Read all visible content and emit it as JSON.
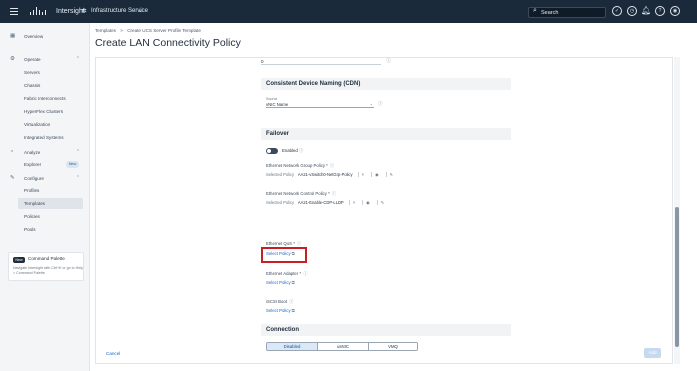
{
  "topbar": {
    "app_name": "Intersight",
    "service_name": "Infrastructure Service",
    "search_placeholder": "Search",
    "icons": [
      "menu-icon",
      "cisco-logo",
      "services-icon",
      "chevron-down-icon",
      "search-icon",
      "status-icon",
      "tasks-icon",
      "notifications-icon",
      "help-icon",
      "user-icon"
    ]
  },
  "sidebar": {
    "overview": "Overview",
    "operate": {
      "label": "Operate",
      "items": [
        "Servers",
        "Chassis",
        "Fabric Interconnects",
        "HyperFlex Clusters",
        "Virtualization",
        "Integrated Systems"
      ]
    },
    "analyze": {
      "label": "Analyze",
      "items": [
        {
          "label": "Explorer",
          "badge": "New"
        }
      ]
    },
    "configure": {
      "label": "Configure",
      "items": [
        "Profiles",
        "Templates",
        "Policies",
        "Pools"
      ],
      "active": "Templates"
    },
    "command_palette": {
      "badge": "New",
      "title": "Command Palette",
      "description": "Navigate Intersight with Ctrl+K or go to Help > Command Palette"
    }
  },
  "header": {
    "breadcrumb": [
      "Templates",
      ">",
      "Create UCS Server Profile Template"
    ],
    "title": "Create LAN Connectivity Policy"
  },
  "form": {
    "top_field_value": "0",
    "cdn": {
      "heading": "Consistent Device Naming (CDN)",
      "source_label": "Source",
      "source_value": "vNIC Name"
    },
    "failover": {
      "heading": "Failover",
      "toggle_label": "Enabled",
      "toggle_on": false
    },
    "network_group": {
      "label": "Ethernet Network Group Policy *",
      "selected_tag": "Selected Policy",
      "selected_name": "AA21-vSwitch0-NetGrp-Policy"
    },
    "network_control": {
      "label": "Ethernet Network Control Policy *",
      "selected_tag": "Selected Policy",
      "selected_name": "AA21-Enable-CDP-LLDP"
    },
    "qos": {
      "label": "Ethernet QoS *",
      "link": "Select Policy"
    },
    "adapter": {
      "label": "Ethernet Adapter *",
      "link": "Select Policy"
    },
    "iscsi": {
      "label": "iSCSI Boot",
      "link": "Select Policy"
    },
    "connection": {
      "heading": "Connection",
      "options": [
        "Disabled",
        "usNIC",
        "VMQ"
      ],
      "selected": "Disabled"
    }
  },
  "footer": {
    "cancel": "Cancel",
    "add": "Add"
  },
  "colors": {
    "topbar": "#1b2a3a",
    "highlight": "#c81e24",
    "link": "#1a67c1"
  }
}
